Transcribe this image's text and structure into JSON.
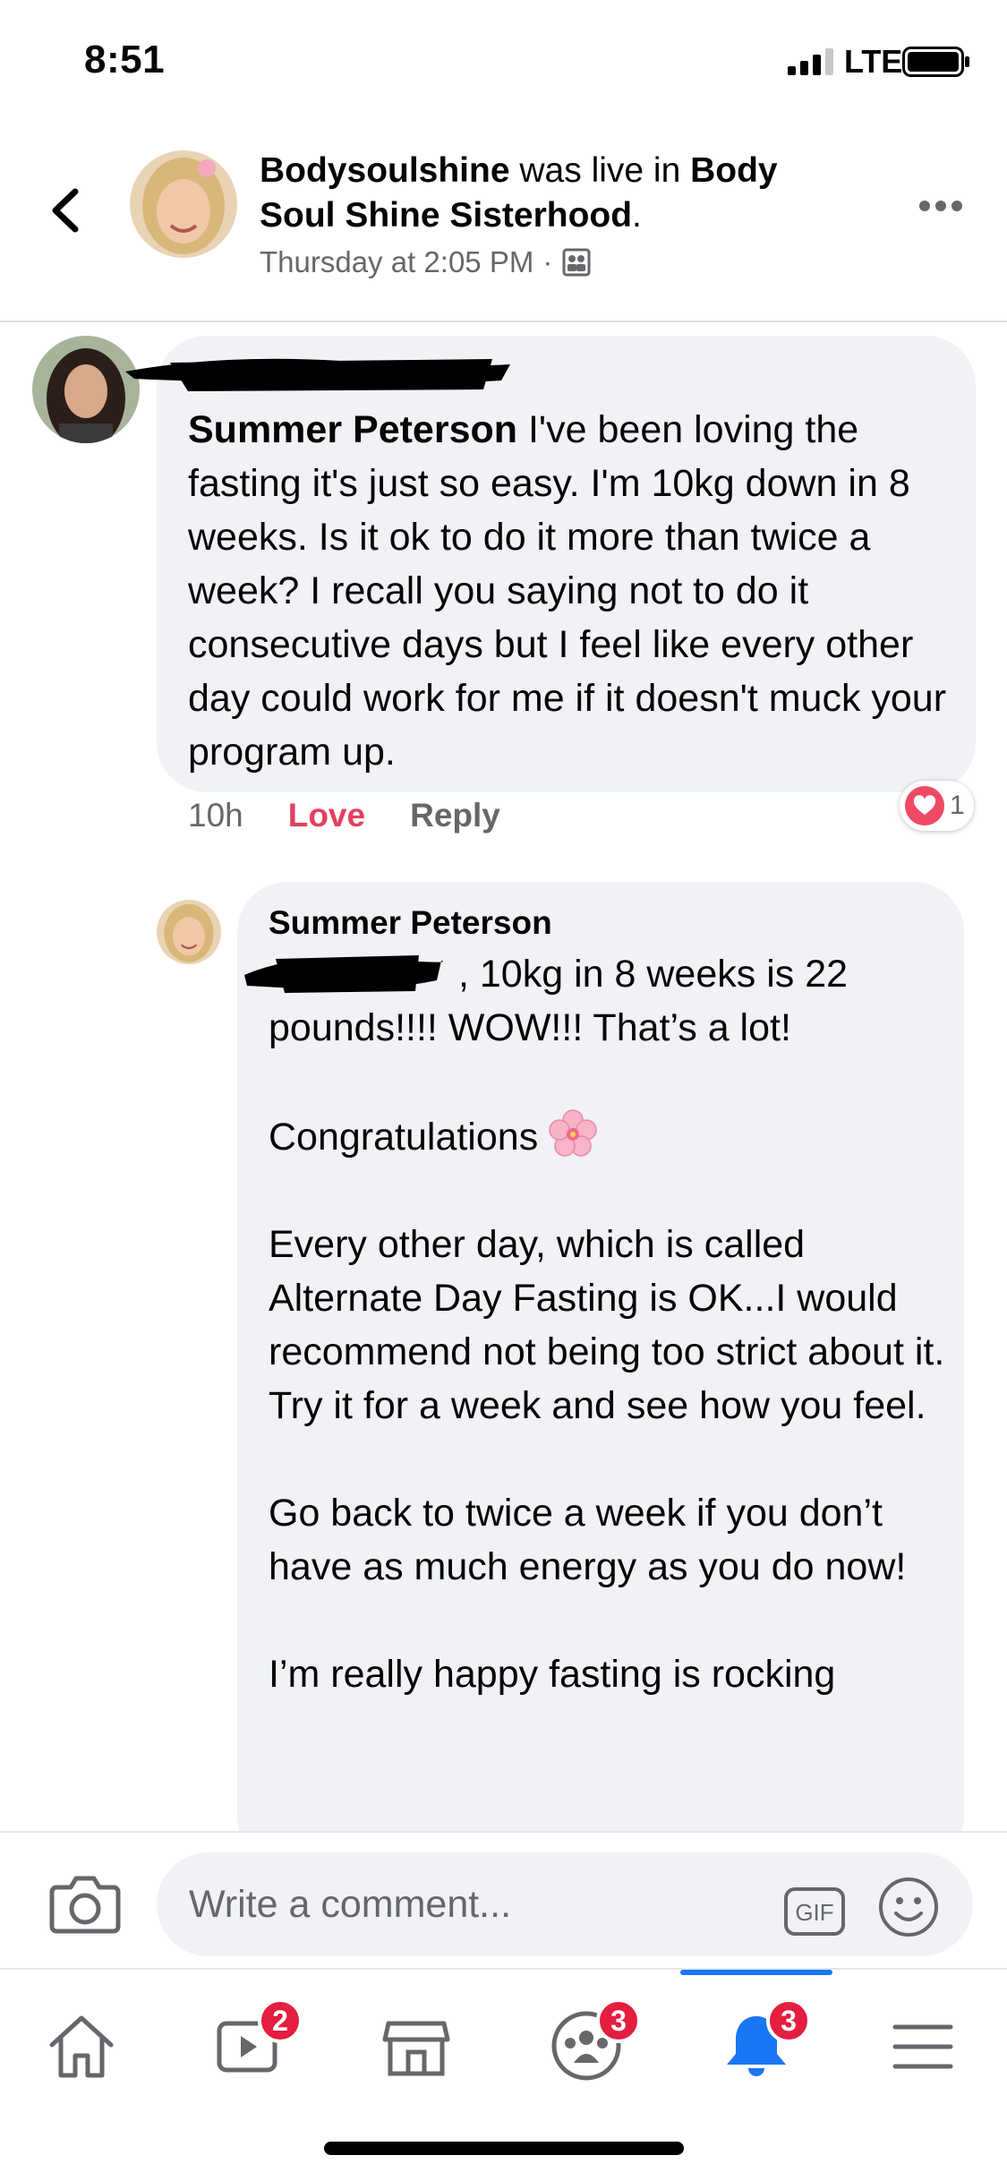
{
  "status_bar": {
    "time": "8:51",
    "network": "LTE"
  },
  "post_header": {
    "author": "Bodysoulshine",
    "action": " was live in ",
    "group": "Body Soul Shine Sisterhood",
    "punct": ".",
    "timestamp": "Thursday at 2:05 PM",
    "separator": "·",
    "audience_icon": "group-audience-icon"
  },
  "comment_1": {
    "mention": "Summer Peterson",
    "text": " I've been loving the fasting it's just so easy. I'm 10kg down in 8 weeks.  Is it ok to do it more than twice a week? I recall you saying not to do it consecutive days but I feel like every other day could work for me if it doesn't muck your program up.",
    "time": "10h",
    "reaction_label": "Love",
    "reply_label": "Reply",
    "reaction_count": "1"
  },
  "comment_2": {
    "name": "Summer Peterson",
    "paragraph_1": ", 10kg in 8 weeks is 22 pounds!!!! WOW!!! That’s a lot!",
    "paragraph_2": "Congratulations",
    "paragraph_3": "Every other day, which is called Alternate Day Fasting is OK...I would recommend not being too strict about it. Try it for a week and see how you feel.",
    "paragraph_4": "Go back to twice a week if you don’t have as much energy as you do now!",
    "paragraph_5": "I’m really happy fasting is rocking"
  },
  "composer": {
    "placeholder": "Write a comment...",
    "gif_label": "GIF"
  },
  "tabbar": {
    "tabs": [
      {
        "name": "home",
        "icon": "home-icon",
        "badge": ""
      },
      {
        "name": "watch",
        "icon": "video-icon",
        "badge": "2"
      },
      {
        "name": "marketplace",
        "icon": "marketplace-icon",
        "badge": ""
      },
      {
        "name": "groups",
        "icon": "groups-icon",
        "badge": "3"
      },
      {
        "name": "notifications",
        "icon": "bell-icon",
        "badge": "3"
      },
      {
        "name": "menu",
        "icon": "menu-icon",
        "badge": ""
      }
    ]
  },
  "colors": {
    "accent": "#1877f2",
    "love": "#e4405f",
    "badge": "#e41e3f",
    "bubble": "#f0f2f5",
    "muted_text": "#65676b"
  }
}
